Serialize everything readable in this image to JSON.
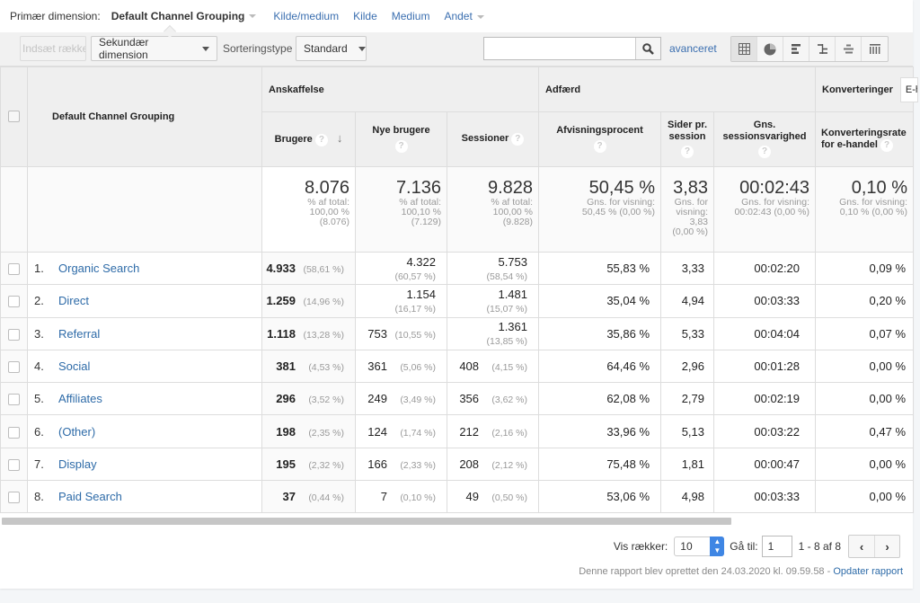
{
  "primary_dimension": {
    "label": "Primær dimension:",
    "current": "Default Channel Grouping",
    "options": [
      "Kilde/medium",
      "Kilde",
      "Medium"
    ],
    "other": "Andet"
  },
  "toolbar": {
    "insert_rows": "Indsæt rækker",
    "secondary_dimension": "Sekundær dimension",
    "sort_type_label": "Sorteringstype",
    "sort_type_value": "Standard",
    "search_value": "",
    "search_placeholder": "",
    "advanced": "avanceret",
    "views": [
      "table-view",
      "pie-view",
      "performance-view",
      "comparison-view",
      "term-cloud-view",
      "pivot-view"
    ]
  },
  "table": {
    "dimension_header": "Default Channel Grouping",
    "groups": {
      "acquisition": "Anskaffelse",
      "behavior": "Adfærd",
      "conversions": "Konverteringer",
      "conversions_select": "E-handel"
    },
    "columns": [
      "Brugere",
      "Nye brugere",
      "Sessioner",
      "Afvisningsprocent",
      "Sider pr. session",
      "Gns. sessionsvarighed",
      "Konverteringsrate for e-handel"
    ],
    "help_glyph": "?",
    "sort_glyph": "↓",
    "totals": [
      {
        "value": "8.076",
        "sub": [
          "% af total:",
          "100,00 %",
          "(8.076)"
        ]
      },
      {
        "value": "7.136",
        "sub": [
          "% af total:",
          "100,10 %",
          "(7.129)"
        ]
      },
      {
        "value": "9.828",
        "sub": [
          "% af total:",
          "100,00 %",
          "(9.828)"
        ]
      },
      {
        "value": "50,45 %",
        "sub": [
          "Gns. for visning:",
          "50,45 % (0,00 %)"
        ]
      },
      {
        "value": "3,83",
        "sub": [
          "Gns. for",
          "visning:",
          "3,83",
          "(0,00 %)"
        ]
      },
      {
        "value": "00:02:43",
        "sub": [
          "Gns. for visning:",
          "00:02:43 (0,00 %)"
        ]
      },
      {
        "value": "0,10 %",
        "sub": [
          "Gns. for visning:",
          "0,10 % (0,00 %)"
        ]
      }
    ],
    "rows": [
      {
        "num": "1.",
        "name": "Organic Search",
        "users": "4.933",
        "users_pct": "(58,61 %)",
        "new_users": "4.322",
        "new_users_pct": "(60,57 %)",
        "sessions": "5.753",
        "sessions_pct": "(58,54 %)",
        "bounce": "55,83 %",
        "pages": "3,33",
        "duration": "00:02:20",
        "conv": "0,09 %"
      },
      {
        "num": "2.",
        "name": "Direct",
        "users": "1.259",
        "users_pct": "(14,96 %)",
        "new_users": "1.154",
        "new_users_pct": "(16,17 %)",
        "sessions": "1.481",
        "sessions_pct": "(15,07 %)",
        "bounce": "35,04 %",
        "pages": "4,94",
        "duration": "00:03:33",
        "conv": "0,20 %"
      },
      {
        "num": "3.",
        "name": "Referral",
        "users": "1.118",
        "users_pct": "(13,28 %)",
        "new_users": "753",
        "new_users_pct": "(10,55 %)",
        "sessions": "1.361",
        "sessions_pct": "(13,85 %)",
        "bounce": "35,86 %",
        "pages": "5,33",
        "duration": "00:04:04",
        "conv": "0,07 %"
      },
      {
        "num": "4.",
        "name": "Social",
        "users": "381",
        "users_pct": "(4,53 %)",
        "new_users": "361",
        "new_users_pct": "(5,06 %)",
        "sessions": "408",
        "sessions_pct": "(4,15 %)",
        "bounce": "64,46 %",
        "pages": "2,96",
        "duration": "00:01:28",
        "conv": "0,00 %"
      },
      {
        "num": "5.",
        "name": "Affiliates",
        "users": "296",
        "users_pct": "(3,52 %)",
        "new_users": "249",
        "new_users_pct": "(3,49 %)",
        "sessions": "356",
        "sessions_pct": "(3,62 %)",
        "bounce": "62,08 %",
        "pages": "2,79",
        "duration": "00:02:19",
        "conv": "0,00 %"
      },
      {
        "num": "6.",
        "name": "(Other)",
        "users": "198",
        "users_pct": "(2,35 %)",
        "new_users": "124",
        "new_users_pct": "(1,74 %)",
        "sessions": "212",
        "sessions_pct": "(2,16 %)",
        "bounce": "33,96 %",
        "pages": "5,13",
        "duration": "00:03:22",
        "conv": "0,47 %"
      },
      {
        "num": "7.",
        "name": "Display",
        "users": "195",
        "users_pct": "(2,32 %)",
        "new_users": "166",
        "new_users_pct": "(2,33 %)",
        "sessions": "208",
        "sessions_pct": "(2,12 %)",
        "bounce": "75,48 %",
        "pages": "1,81",
        "duration": "00:00:47",
        "conv": "0,00 %"
      },
      {
        "num": "8.",
        "name": "Paid Search",
        "users": "37",
        "users_pct": "(0,44 %)",
        "new_users": "7",
        "new_users_pct": "(0,10 %)",
        "sessions": "49",
        "sessions_pct": "(0,50 %)",
        "bounce": "53,06 %",
        "pages": "4,98",
        "duration": "00:03:33",
        "conv": "0,00 %"
      }
    ]
  },
  "pagination": {
    "show_rows_label": "Vis rækker:",
    "show_rows_value": "10",
    "goto_label": "Gå til:",
    "goto_value": "1",
    "range": "1 - 8 af 8",
    "prev": "‹",
    "next": "›"
  },
  "footer": {
    "text": "Denne rapport blev oprettet den 24.03.2020 kl. 09.59.58 - ",
    "link": "Opdater rapport"
  },
  "colors": {
    "link": "#2e6ba8",
    "header_bg": "#efefef",
    "toolbar_bg": "#f1f1f1",
    "spinner": "#3f86e4"
  }
}
